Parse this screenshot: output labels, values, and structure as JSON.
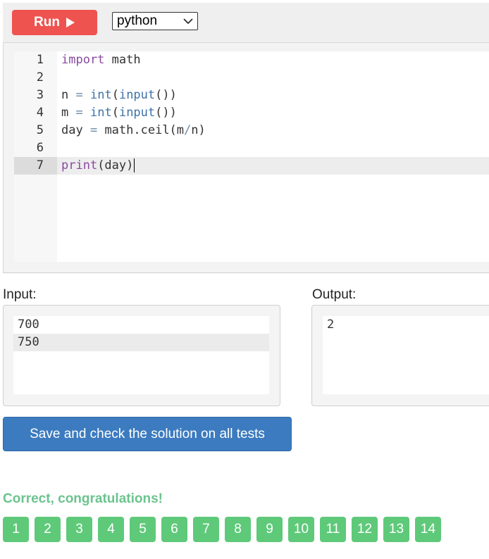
{
  "toolbar": {
    "run_label": "Run",
    "language": "python"
  },
  "editor": {
    "lines": [
      {
        "num": "1",
        "tokens": [
          {
            "t": "import",
            "c": "kw"
          },
          {
            "t": " math",
            "c": ""
          }
        ]
      },
      {
        "num": "2",
        "tokens": []
      },
      {
        "num": "3",
        "tokens": [
          {
            "t": "n ",
            "c": ""
          },
          {
            "t": "=",
            "c": "op"
          },
          {
            "t": " ",
            "c": ""
          },
          {
            "t": "int",
            "c": "bi"
          },
          {
            "t": "(",
            "c": ""
          },
          {
            "t": "input",
            "c": "bi"
          },
          {
            "t": "())",
            "c": ""
          }
        ]
      },
      {
        "num": "4",
        "tokens": [
          {
            "t": "m ",
            "c": ""
          },
          {
            "t": "=",
            "c": "op"
          },
          {
            "t": " ",
            "c": ""
          },
          {
            "t": "int",
            "c": "bi"
          },
          {
            "t": "(",
            "c": ""
          },
          {
            "t": "input",
            "c": "bi"
          },
          {
            "t": "())",
            "c": ""
          }
        ]
      },
      {
        "num": "5",
        "tokens": [
          {
            "t": "day ",
            "c": ""
          },
          {
            "t": "=",
            "c": "op"
          },
          {
            "t": " math.ceil(m",
            "c": ""
          },
          {
            "t": "/",
            "c": "op"
          },
          {
            "t": "n)",
            "c": ""
          }
        ]
      },
      {
        "num": "6",
        "tokens": []
      },
      {
        "num": "7",
        "tokens": [
          {
            "t": "print",
            "c": "kw"
          },
          {
            "t": "(day)",
            "c": ""
          }
        ],
        "active": true
      }
    ]
  },
  "input": {
    "label": "Input:",
    "lines": [
      "700",
      "750"
    ]
  },
  "output": {
    "label": "Output:",
    "lines": [
      "2"
    ]
  },
  "save_button": "Save and check the solution on all tests",
  "result": {
    "message": "Correct, congratulations!",
    "tests": [
      "1",
      "2",
      "3",
      "4",
      "5",
      "6",
      "7",
      "8",
      "9",
      "10",
      "11",
      "12",
      "13",
      "14"
    ]
  },
  "colors": {
    "run": "#ef5350",
    "save": "#3c7bbf",
    "success_text": "#6cc38f",
    "test_pass": "#5fc97a"
  }
}
